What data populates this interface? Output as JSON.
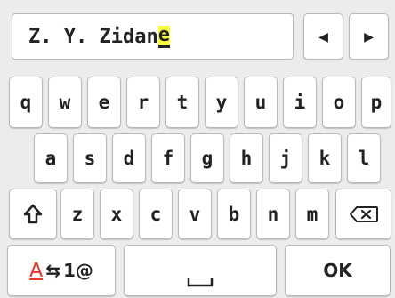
{
  "input": {
    "prefix": "Z. Y. Zidan",
    "cursor_char": "e"
  },
  "cursor_left_label": "◀",
  "cursor_right_label": "▶",
  "keyboard": {
    "row1": [
      "q",
      "w",
      "e",
      "r",
      "t",
      "y",
      "u",
      "i",
      "o",
      "p"
    ],
    "row2": [
      "a",
      "s",
      "d",
      "f",
      "g",
      "h",
      "j",
      "k",
      "l"
    ],
    "row3": [
      "z",
      "x",
      "c",
      "v",
      "b",
      "n",
      "m"
    ],
    "shift_icon": "shift-up-arrow",
    "backspace_icon": "backspace-x"
  },
  "bottom": {
    "mode_current": "A",
    "mode_switch_symbol": "⇆",
    "mode_next": "1@",
    "space_icon": "space-bar",
    "ok_label": "OK"
  }
}
